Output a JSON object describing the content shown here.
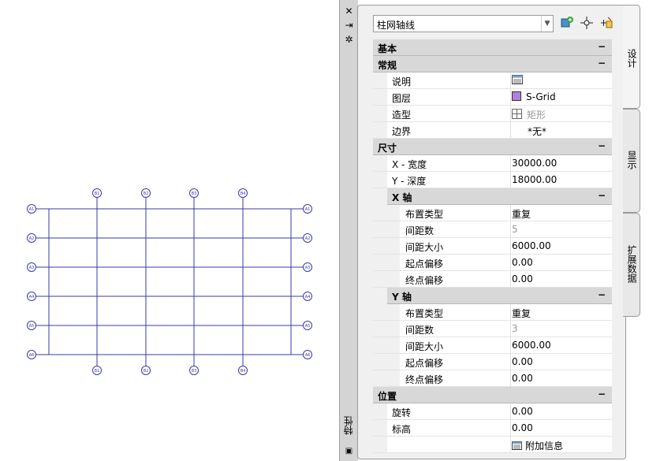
{
  "style_select": {
    "value": "柱网轴线"
  },
  "toolbar": {
    "tools": [
      {
        "icon": "add-style-icon"
      },
      {
        "icon": "select-target-icon"
      },
      {
        "icon": "quick-select-icon"
      }
    ]
  },
  "strip": {
    "title": "特性"
  },
  "tabs": [
    "设计",
    "显示",
    "扩展数据"
  ],
  "sections": {
    "basic": "基本",
    "general": "常规",
    "dimensions": "尺寸",
    "x_axis": "X 轴",
    "y_axis": "Y 轴",
    "location": "位置"
  },
  "general": {
    "description": {
      "label": "说明",
      "value": ""
    },
    "layer": {
      "label": "图层",
      "value": "S-Grid",
      "color": "#b57edc"
    },
    "shape": {
      "label": "造型",
      "value": "矩形"
    },
    "boundary": {
      "label": "边界",
      "value": "*无*"
    }
  },
  "dimensions": {
    "x_width": {
      "label": "X - 宽度",
      "value": "30000.00"
    },
    "y_depth": {
      "label": "Y - 深度",
      "value": "18000.00"
    }
  },
  "x_axis": {
    "layout": {
      "label": "布置类型",
      "value": "重复"
    },
    "count": {
      "label": "间距数",
      "value": "5"
    },
    "size": {
      "label": "间距大小",
      "value": "6000.00"
    },
    "start": {
      "label": "起点偏移",
      "value": "0.00"
    },
    "end": {
      "label": "终点偏移",
      "value": "0.00"
    }
  },
  "y_axis": {
    "layout": {
      "label": "布置类型",
      "value": "重复"
    },
    "count": {
      "label": "间距数",
      "value": "3"
    },
    "size": {
      "label": "间距大小",
      "value": "6000.00"
    },
    "start": {
      "label": "起点偏移",
      "value": "0.00"
    },
    "end": {
      "label": "终点偏移",
      "value": "0.00"
    }
  },
  "location": {
    "rotation": {
      "label": "旋转",
      "value": "0.00"
    },
    "elevation": {
      "label": "标高",
      "value": "0.00"
    },
    "extra": {
      "label": "附加信息"
    }
  },
  "drawing": {
    "line_color": "#3a3aa8",
    "top_bubbles": [
      "B1",
      "B2",
      "B3",
      "B4"
    ],
    "bottom_bubbles": [
      "B1",
      "B2",
      "B3",
      "B4"
    ],
    "left_bubbles": [
      "A1",
      "A2",
      "A3",
      "A4",
      "A5",
      "A6"
    ],
    "right_bubbles": [
      "A1",
      "A2",
      "A3",
      "A4",
      "A5",
      "A6"
    ]
  }
}
